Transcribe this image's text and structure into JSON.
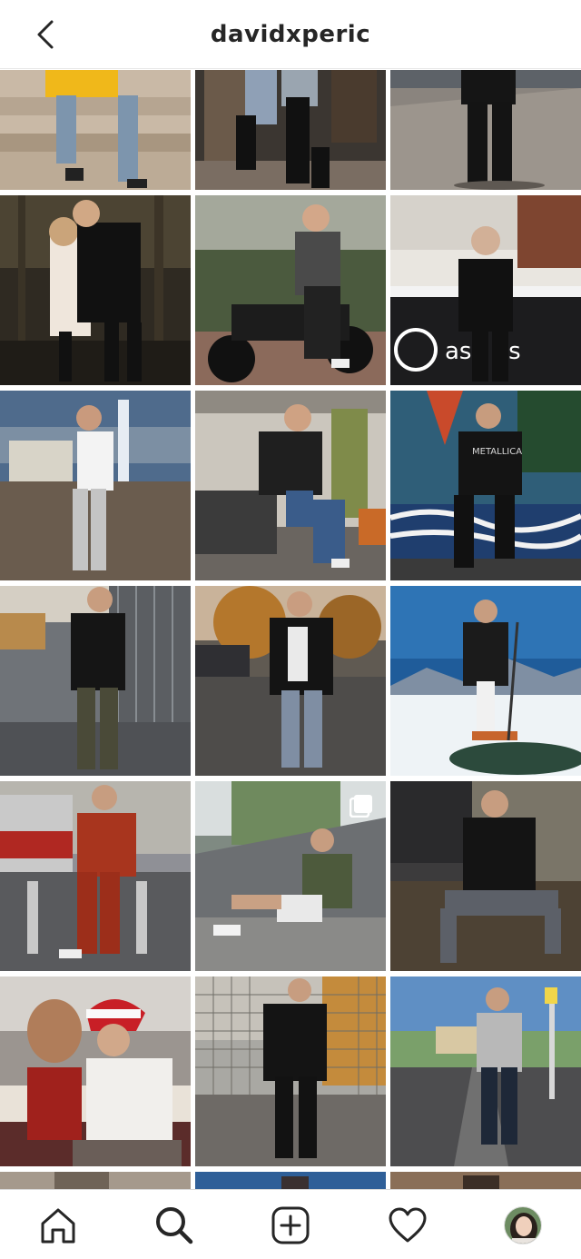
{
  "header": {
    "title": "davidxperic",
    "back_icon": "chevron-left-icon"
  },
  "grid": {
    "columns": 3,
    "visible_rows": 6,
    "posts": [
      {
        "index": 1,
        "multi": false
      },
      {
        "index": 2,
        "multi": false
      },
      {
        "index": 3,
        "multi": false
      },
      {
        "index": 4,
        "multi": false
      },
      {
        "index": 5,
        "multi": false
      },
      {
        "index": 6,
        "multi": false,
        "sign_text": "asp as"
      },
      {
        "index": 7,
        "multi": false
      },
      {
        "index": 8,
        "multi": false
      },
      {
        "index": 9,
        "multi": false,
        "shirt_text": "METALLICA"
      },
      {
        "index": 10,
        "multi": false
      },
      {
        "index": 11,
        "multi": false
      },
      {
        "index": 12,
        "multi": false
      },
      {
        "index": 13,
        "multi": false
      },
      {
        "index": 14,
        "multi": true
      },
      {
        "index": 15,
        "multi": false
      },
      {
        "index": 16,
        "multi": false
      },
      {
        "index": 17,
        "multi": false
      },
      {
        "index": 18,
        "multi": false
      }
    ]
  },
  "tabbar": {
    "items": [
      {
        "name": "home",
        "icon": "home-icon"
      },
      {
        "name": "search",
        "icon": "search-icon",
        "active": true
      },
      {
        "name": "new-post",
        "icon": "add-post-icon"
      },
      {
        "name": "activity",
        "icon": "heart-icon"
      },
      {
        "name": "profile",
        "icon": "avatar"
      }
    ]
  },
  "colors": {
    "text": "#262626",
    "border": "#dbdbdb",
    "background": "#ffffff"
  }
}
